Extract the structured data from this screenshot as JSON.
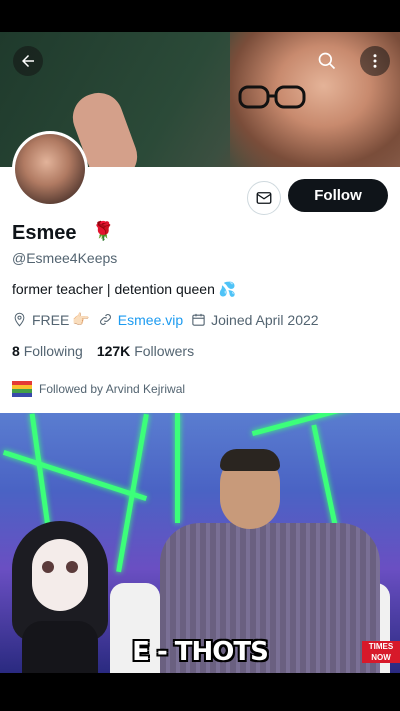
{
  "profile": {
    "display_name": "Esmee",
    "name_emoji": "🌹",
    "handle": "@Esmee4Keeps",
    "bio": "former teacher | detention queen",
    "bio_emoji": "💦",
    "location": "FREE",
    "location_emoji": "👉🏻",
    "website": "Esmee.vip",
    "joined": "Joined April 2022",
    "following_count": "8",
    "following_label": "Following",
    "followers_count": "127K",
    "followers_label": "Followers",
    "followed_by": "Followed by Arvind Kejriwal"
  },
  "actions": {
    "follow_label": "Follow"
  },
  "video": {
    "caption": "E - THOTS",
    "channel_line1": "TIMES",
    "channel_line2": "NOW"
  },
  "icons": {
    "back": "arrow-left-icon",
    "search": "search-icon",
    "more": "more-vertical-icon",
    "message": "mail-icon",
    "location": "location-pin-icon",
    "link": "link-icon",
    "calendar": "calendar-icon",
    "followed_flag": "pride-flag-icon"
  },
  "colors": {
    "follow_button_bg": "#0f1419",
    "link": "#1d9bf0",
    "secondary_text": "#536471",
    "neon_green": "#3cff7a"
  }
}
